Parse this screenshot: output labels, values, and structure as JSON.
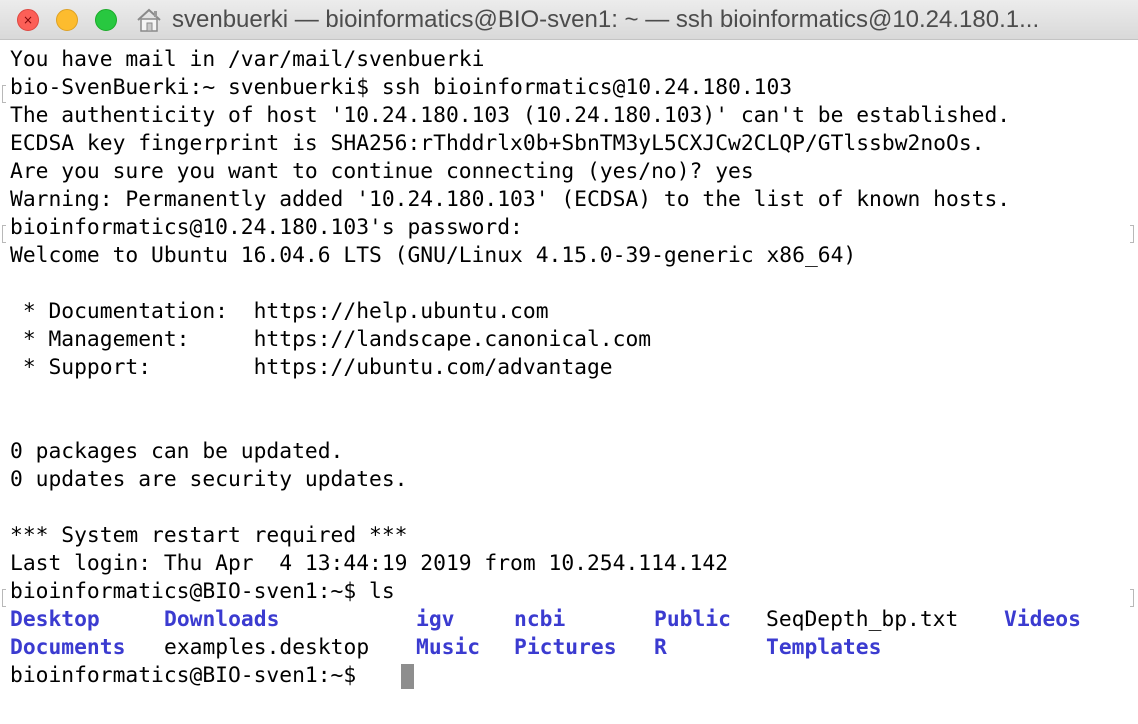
{
  "window": {
    "title": "svenbuerki — bioinformatics@BIO-sven1: ~ — ssh bioinformatics@10.24.180.1...",
    "close_glyph": "×",
    "icon": "home-folder-icon"
  },
  "terminal": {
    "lines": [
      "You have mail in /var/mail/svenbuerki",
      "bio-SvenBuerki:~ svenbuerki$ ssh bioinformatics@10.24.180.103",
      "The authenticity of host '10.24.180.103 (10.24.180.103)' can't be established.",
      "ECDSA key fingerprint is SHA256:rThddrlx0b+SbnTM3yL5CXJCw2CLQP/GTlssbw2noOs.",
      "Are you sure you want to continue connecting (yes/no)? yes",
      "Warning: Permanently added '10.24.180.103' (ECDSA) to the list of known hosts.",
      "bioinformatics@10.24.180.103's password:",
      "Welcome to Ubuntu 16.04.6 LTS (GNU/Linux 4.15.0-39-generic x86_64)",
      "",
      " * Documentation:  https://help.ubuntu.com",
      " * Management:     https://landscape.canonical.com",
      " * Support:        https://ubuntu.com/advantage",
      "",
      "",
      "0 packages can be updated.",
      "0 updates are security updates.",
      "",
      "*** System restart required ***",
      "Last login: Thu Apr  4 13:44:19 2019 from 10.254.114.142",
      "bioinformatics@BIO-sven1:~$ ls"
    ],
    "ls_row1": [
      "Desktop",
      "Downloads",
      "igv",
      "ncbi",
      "Public",
      "SeqDepth_bp.txt",
      "Videos"
    ],
    "ls_row2": [
      "Documents",
      "examples.desktop",
      "Music",
      "Pictures",
      "R",
      "Templates"
    ],
    "prompt": "bioinformatics@BIO-sven1:~$ ",
    "colors": {
      "directory": "#3b3bd0",
      "text": "#000000",
      "cursor": "#8e8e8e"
    }
  }
}
